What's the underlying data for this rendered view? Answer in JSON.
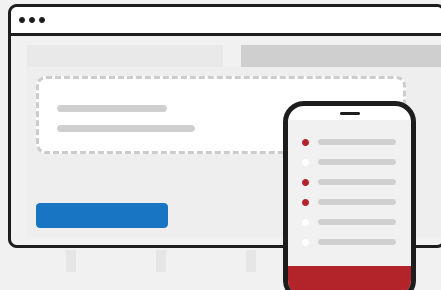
{
  "colors": {
    "background": "#f1f1f1",
    "outline": "#1d1d1d",
    "accent_blue": "#1775c3",
    "accent_red": "#b3232a",
    "placeholder_line": "#cfcfcf",
    "dashed_border": "#cccccc"
  },
  "window": {
    "controls": [
      "window-dot-icon",
      "window-dot-icon",
      "window-dot-icon"
    ]
  },
  "card": {
    "text_lines": 2,
    "has_outline_button": true
  },
  "phone": {
    "list_items": [
      {
        "marker": "bullet-filled",
        "color": "#b3232a"
      },
      {
        "marker": "bullet-empty",
        "color": "#ffffff"
      },
      {
        "marker": "bullet-filled",
        "color": "#b3232a"
      },
      {
        "marker": "bullet-filled",
        "color": "#b3232a"
      },
      {
        "marker": "bullet-empty",
        "color": "#ffffff"
      },
      {
        "marker": "bullet-empty",
        "color": "#ffffff"
      }
    ]
  }
}
